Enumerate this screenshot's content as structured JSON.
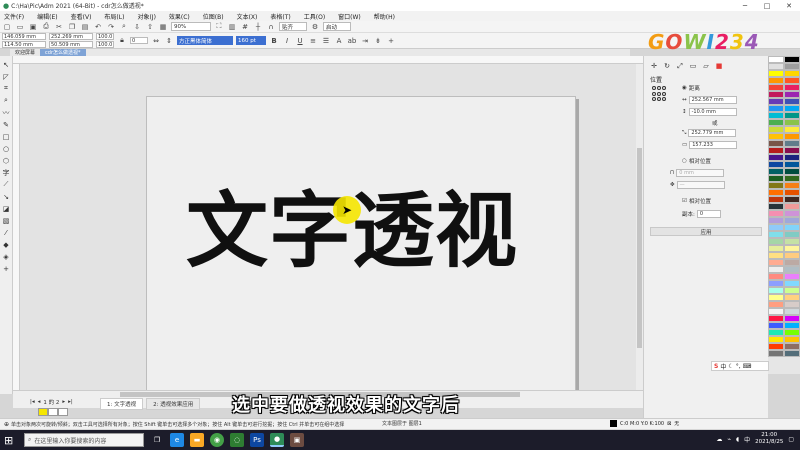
{
  "window": {
    "title": "C:\\Ha\\Pic\\Adm 2021 (64-Bit) - cdr怎么做透视*",
    "controls": [
      "─",
      "□",
      "✕"
    ]
  },
  "menu": [
    "文件(F)",
    "编辑(E)",
    "查看(V)",
    "布局(L)",
    "对象(J)",
    "效果(C)",
    "位图(B)",
    "文本(X)",
    "表格(T)",
    "工具(O)",
    "窗口(W)",
    "帮助(H)"
  ],
  "toolbar": {
    "zoom": "90%",
    "snap_label": "贴齐",
    "launch_label": "启动"
  },
  "propbar": {
    "x": "146.059 mm",
    "y": "114.50 mm",
    "w": "252.269 mm",
    "h": "50.509 mm",
    "sx": "100.0",
    "sy": "100.0",
    "angle": "0",
    "font": "方正黑体简体",
    "size": "160 pt"
  },
  "doc_tabs": [
    "欢迎屏幕",
    "cdr怎么做透视*"
  ],
  "canvas": {
    "text": "文字透视",
    "text_color": "#101010",
    "highlight_color": "#f5e600"
  },
  "pager": {
    "label": "1 的 2",
    "tabs": [
      "1: 文字透视",
      "2: 透视效果应用"
    ]
  },
  "caption": "选中要做透视效果的文字后",
  "status": {
    "hint": "单击对象两次可旋转/倾斜；双击工具可选择所有对象；按住 Shift 键单击可选择多个对象；按住 Alt 键单击可进行挖掘；按住 Ctrl 并单击可在组中选择",
    "object": "文本图层于 图层1",
    "fill_value": "C:0 M:0 Y:0 K:100",
    "none_label": "无"
  },
  "docker": {
    "title": "位置",
    "relative_label": "距离",
    "x_val": "252.567 mm",
    "y_val": "-10.0 mm",
    "or_label": "或",
    "x2_val": "252.779 mm",
    "y2_val": "157.233",
    "ratio_label": "相对位置",
    "size_label": "相对位置",
    "disabled1": "0 mm",
    "disabled2": "—",
    "keep_ratio": "相对位置",
    "copies_label": "副本:",
    "copies": "0",
    "apply": "应用"
  },
  "watermark": [
    "G",
    "O",
    "W",
    "I",
    "2",
    "3",
    "4"
  ],
  "palette": [
    "#ffffff",
    "#000000",
    "#e0e0e0",
    "#9e9e9e",
    "#ffff00",
    "#ffd600",
    "#ff9800",
    "#ff5722",
    "#f44336",
    "#e91e63",
    "#c2185b",
    "#9c27b0",
    "#673ab7",
    "#3f51b5",
    "#2196f3",
    "#03a9f4",
    "#00bcd4",
    "#009688",
    "#4caf50",
    "#8bc34a",
    "#cddc39",
    "#ffeb3b",
    "#ffc107",
    "#ff9800",
    "#795548",
    "#607d8b",
    "#b71c1c",
    "#880e4f",
    "#4a148c",
    "#1a237e",
    "#0d47a1",
    "#01579b",
    "#006064",
    "#004d40",
    "#1b5e20",
    "#33691e",
    "#827717",
    "#f57f17",
    "#ff6f00",
    "#e65100",
    "#bf360c",
    "#3e2723",
    "#263238",
    "#ef9a9a",
    "#f48fb1",
    "#ce93d8",
    "#b39ddb",
    "#9fa8da",
    "#90caf9",
    "#81d4fa",
    "#80deea",
    "#80cbc4",
    "#a5d6a7",
    "#c5e1a5",
    "#e6ee9c",
    "#fff59d",
    "#ffe082",
    "#ffcc80",
    "#ffab91",
    "#bcaaa4",
    "#eeeeee",
    "#b0bec5",
    "#ff8a80",
    "#ea80fc",
    "#8c9eff",
    "#80d8ff",
    "#a7ffeb",
    "#ccff90",
    "#ffff8d",
    "#ffd180",
    "#ff9e80",
    "#d7ccc8",
    "#f5f5f5",
    "#cfd8dc",
    "#ff1744",
    "#d500f9",
    "#3d5afe",
    "#00b0ff",
    "#1de9b6",
    "#76ff03",
    "#ffea00",
    "#ffc400",
    "#ff3d00",
    "#8d6e63",
    "#757575",
    "#546e7a"
  ],
  "taskbar": {
    "search_placeholder": "在这里输入你要搜索的内容",
    "time": "21:00",
    "date": "2021/8/25"
  }
}
